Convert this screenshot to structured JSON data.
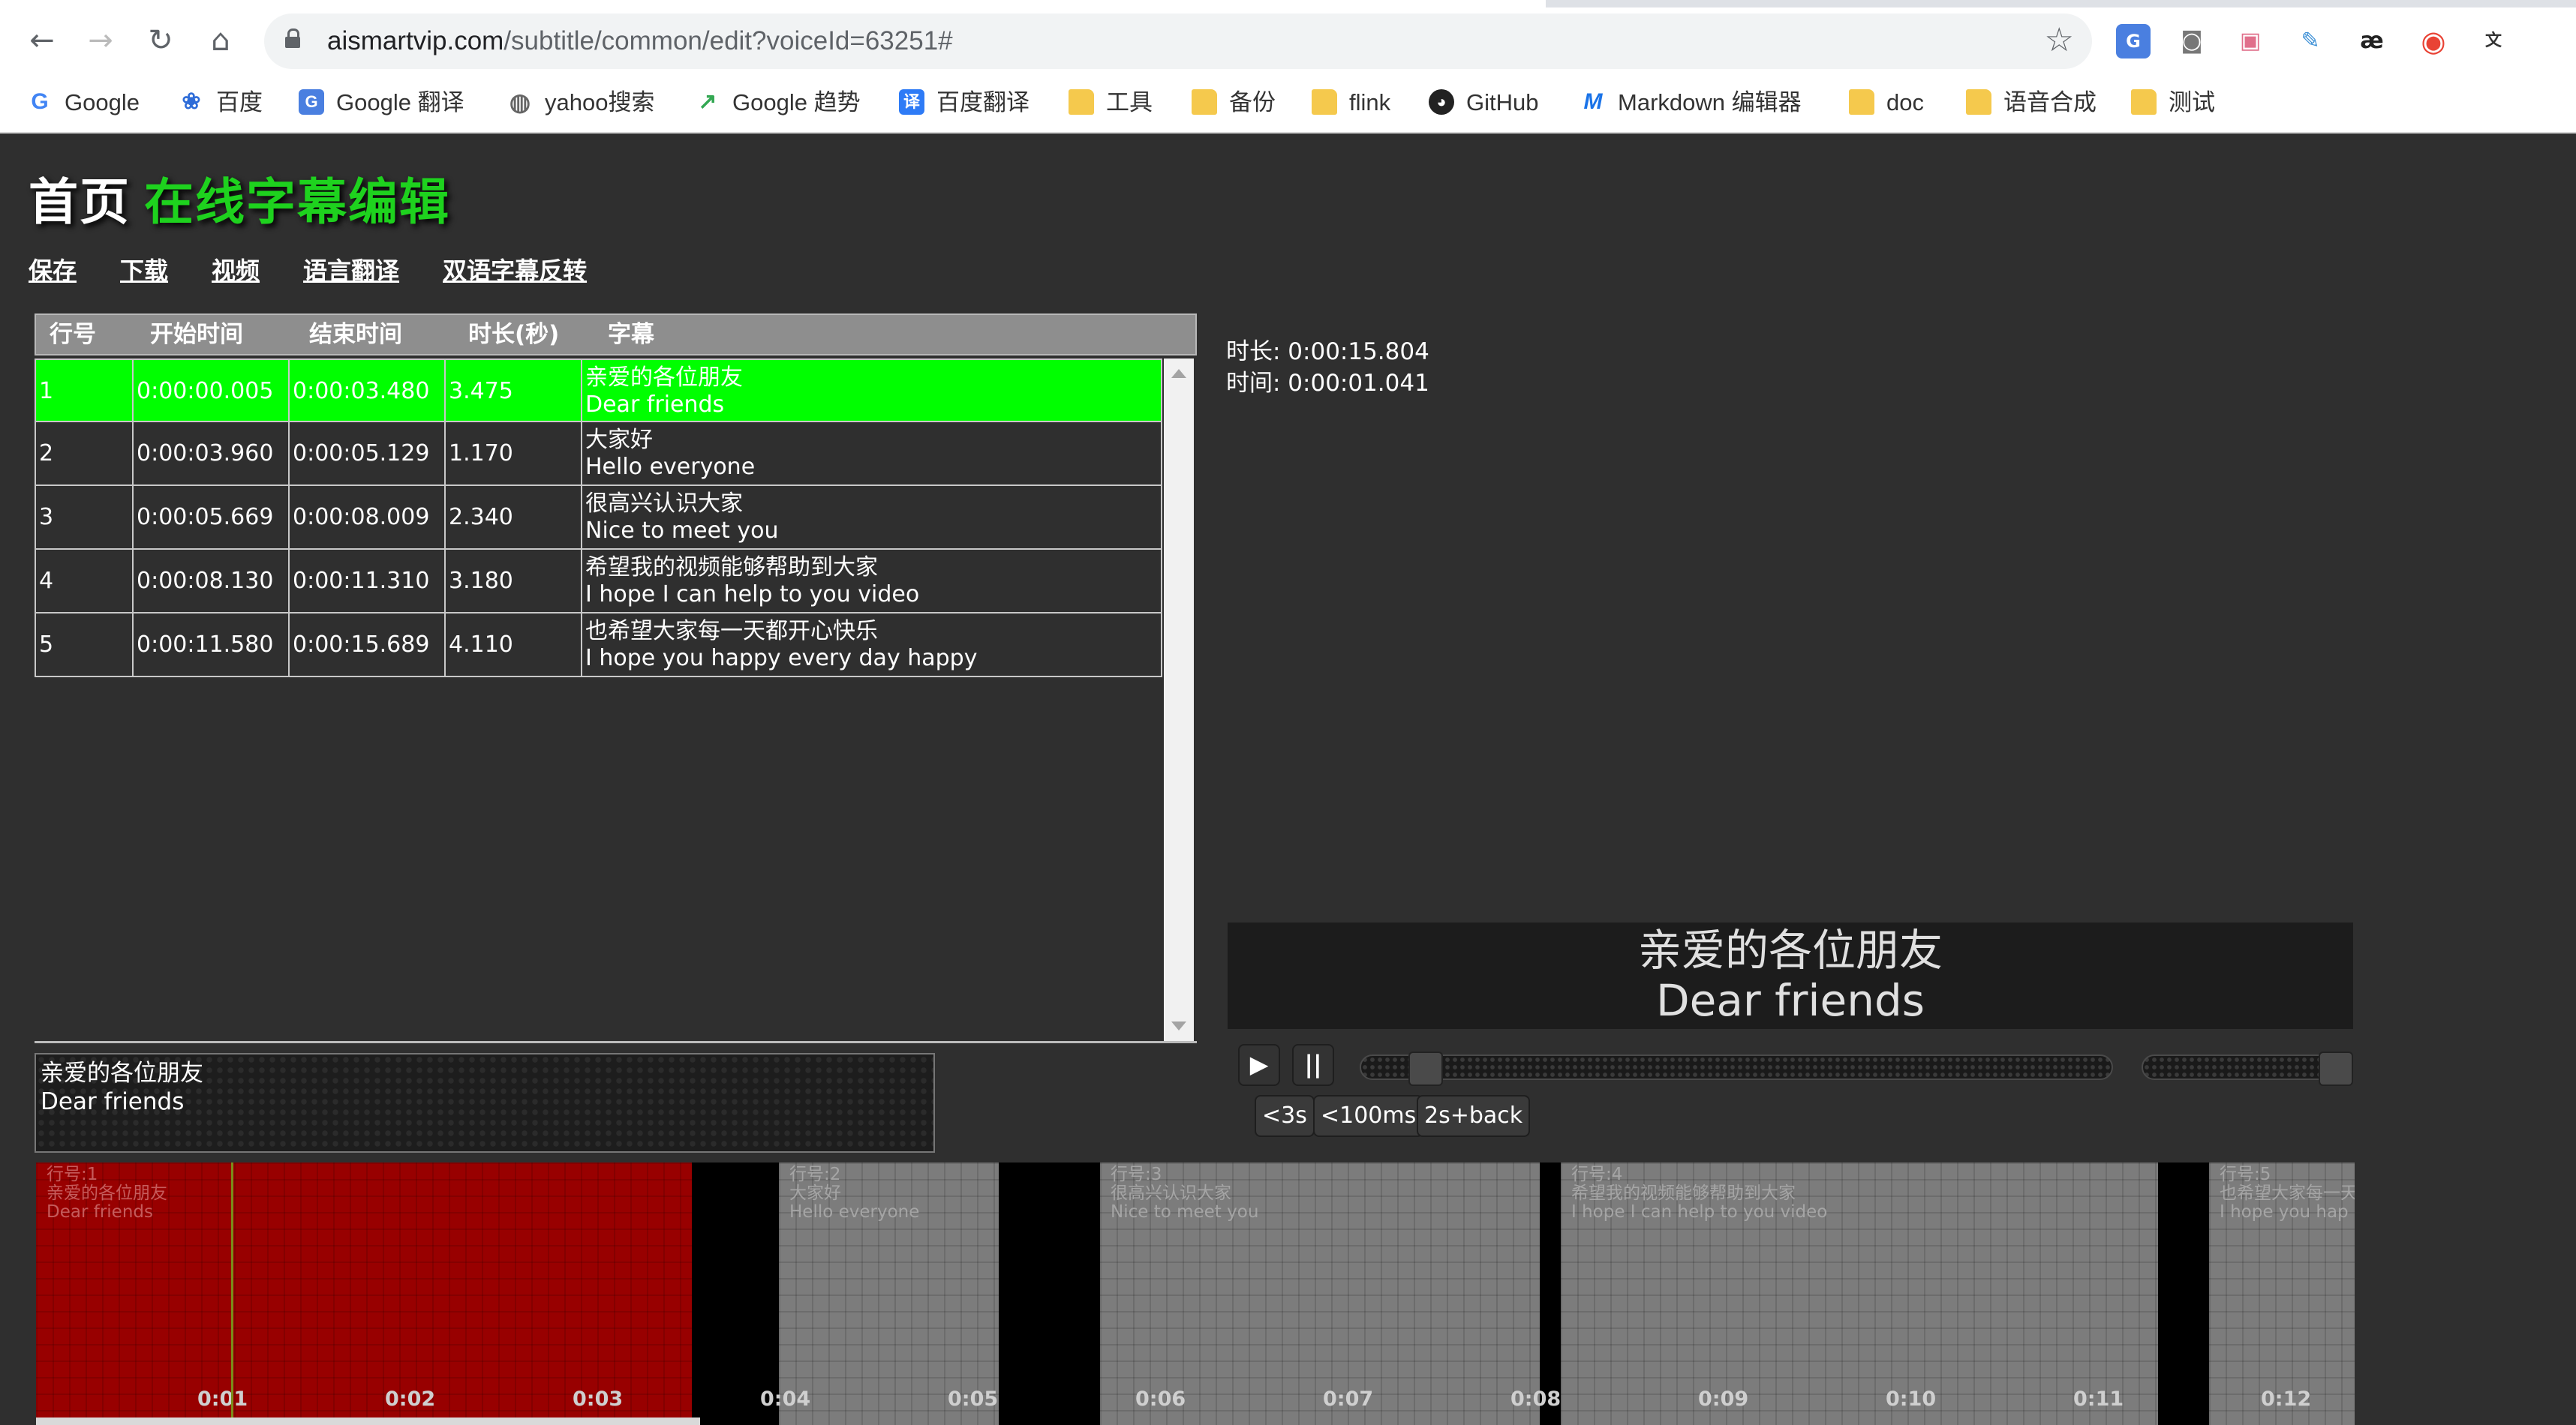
{
  "browser": {
    "url_host": "aismartvip.com",
    "url_path": "/subtitle/common/edit?voiceId=63251#",
    "bookmarks": [
      {
        "label": "Google"
      },
      {
        "label": "百度"
      },
      {
        "label": "Google 翻译"
      },
      {
        "label": "yahoo搜索"
      },
      {
        "label": "Google 趋势"
      },
      {
        "label": "百度翻译"
      },
      {
        "label": "工具"
      },
      {
        "label": "备份"
      },
      {
        "label": "flink"
      },
      {
        "label": "GitHub"
      },
      {
        "label": "Markdown 编辑器"
      },
      {
        "label": "doc"
      },
      {
        "label": "语音合成"
      },
      {
        "label": "测试"
      }
    ]
  },
  "header": {
    "home": "首页",
    "title": "在线字幕编辑"
  },
  "menu": [
    "保存",
    "下载",
    "视频",
    "语言翻译",
    "双语字幕反转"
  ],
  "table": {
    "columns": [
      "行号",
      "开始时间",
      "结束时间",
      "时长(秒)",
      "字幕"
    ],
    "rows": [
      {
        "no": "1",
        "start": "0:00:00.005",
        "end": "0:00:03.480",
        "dur": "3.475",
        "zh": "亲爱的各位朋友",
        "en": "Dear friends"
      },
      {
        "no": "2",
        "start": "0:00:03.960",
        "end": "0:00:05.129",
        "dur": "1.170",
        "zh": "大家好",
        "en": "Hello everyone"
      },
      {
        "no": "3",
        "start": "0:00:05.669",
        "end": "0:00:08.009",
        "dur": "2.340",
        "zh": "很高兴认识大家",
        "en": "Nice to meet you"
      },
      {
        "no": "4",
        "start": "0:00:08.130",
        "end": "0:00:11.310",
        "dur": "3.180",
        "zh": "希望我的视频能够帮助到大家",
        "en": "I hope I can help to you video"
      },
      {
        "no": "5",
        "start": "0:00:11.580",
        "end": "0:00:15.689",
        "dur": "4.110",
        "zh": "也希望大家每一天都开心快乐",
        "en": "I hope you happy every day happy"
      }
    ]
  },
  "editor": {
    "line1": "亲爱的各位朋友",
    "line2": "Dear friends"
  },
  "info": {
    "duration": "时长: 0:00:15.804",
    "time": "时间: 0:00:01.041"
  },
  "preview": {
    "line1": "亲爱的各位朋友",
    "line2": "Dear friends"
  },
  "player": {
    "play_icon": "play-icon",
    "pause_icon": "pause-icon",
    "buttons": [
      "<3s",
      "<100ms",
      "2s+back"
    ],
    "progress_fraction": 0.066,
    "volume_fraction": 1.0
  },
  "timeline": {
    "segments": [
      {
        "label": "行号:1",
        "zh": "亲爱的各位朋友",
        "en": "Dear friends"
      },
      {
        "label": "行号:2",
        "zh": "大家好",
        "en": "Hello everyone"
      },
      {
        "label": "行号:3",
        "zh": "很高兴认识大家",
        "en": "Nice to meet you"
      },
      {
        "label": "行号:4",
        "zh": "希望我的视频能够帮助到大家",
        "en": "I hope I can help to you video"
      },
      {
        "label": "行号:5",
        "zh": "也希望大家每一天",
        "en": "I hope you hap"
      }
    ],
    "ticks": [
      "0:01",
      "0:02",
      "0:03",
      "0:04",
      "0:05",
      "0:06",
      "0:07",
      "0:08",
      "0:09",
      "0:10",
      "0:11",
      "0:12"
    ]
  }
}
